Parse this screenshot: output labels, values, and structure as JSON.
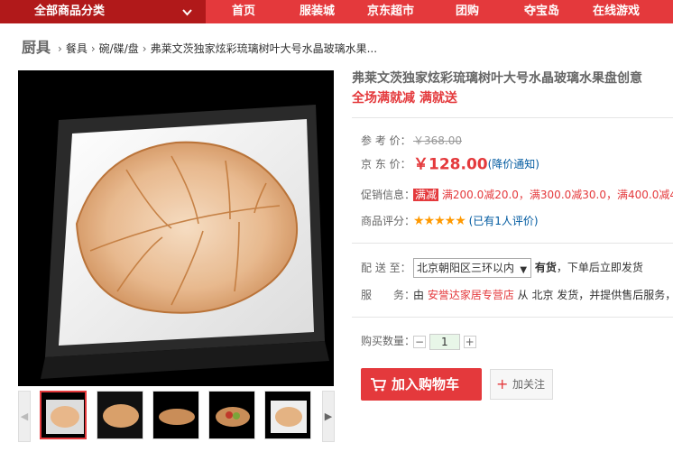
{
  "topnav": {
    "all_categories": "全部商品分类",
    "items": [
      "首页",
      "服装城",
      "京东超市",
      "团购",
      "夺宝岛",
      "在线游戏"
    ]
  },
  "breadcrumb": {
    "root": "厨具",
    "level1": "餐具",
    "level2": "碗/碟/盘",
    "current": "弗莱文茨独家炫彩琉璃树叶大号水晶玻璃水果..."
  },
  "product": {
    "title": "弗莱文茨独家炫彩琉璃树叶大号水晶玻璃水果盘创意",
    "promo": "全场满就减 满就送",
    "ref_price_label": "参 考 价：",
    "ref_price": "￥368.00",
    "jd_price_label": "京 东 价：",
    "jd_price": "￥128.00",
    "price_notify": "(降价通知)",
    "promotion_label": "促销信息：",
    "promotion_tag": "满减",
    "promotion_text": "满200.0减20.0，满300.0减30.0，满400.0减40",
    "rating_label": "商品评分：",
    "stars": "★★★★★",
    "rating_count": "(已有1人评价)",
    "delivery_label": "配 送 至：",
    "delivery_region": "北京朝阳区三环以内",
    "stock_status": "有货",
    "stock_note": "，下单后立即发货",
    "service_label": "服　　务：",
    "service_prefix": "由 ",
    "store_name": "安誉达家居专营店",
    "service_suffix": " 从 北京 发货，并提供售后服务，",
    "quantity_label": "购买数量：",
    "quantity": "1",
    "minus": "−",
    "plus": "+",
    "add_to_cart": "加入购物车",
    "follow": "加关注"
  },
  "colors": {
    "brand_red": "#e4393c",
    "dark_red": "#b1191a",
    "link_blue": "#005aa0"
  }
}
